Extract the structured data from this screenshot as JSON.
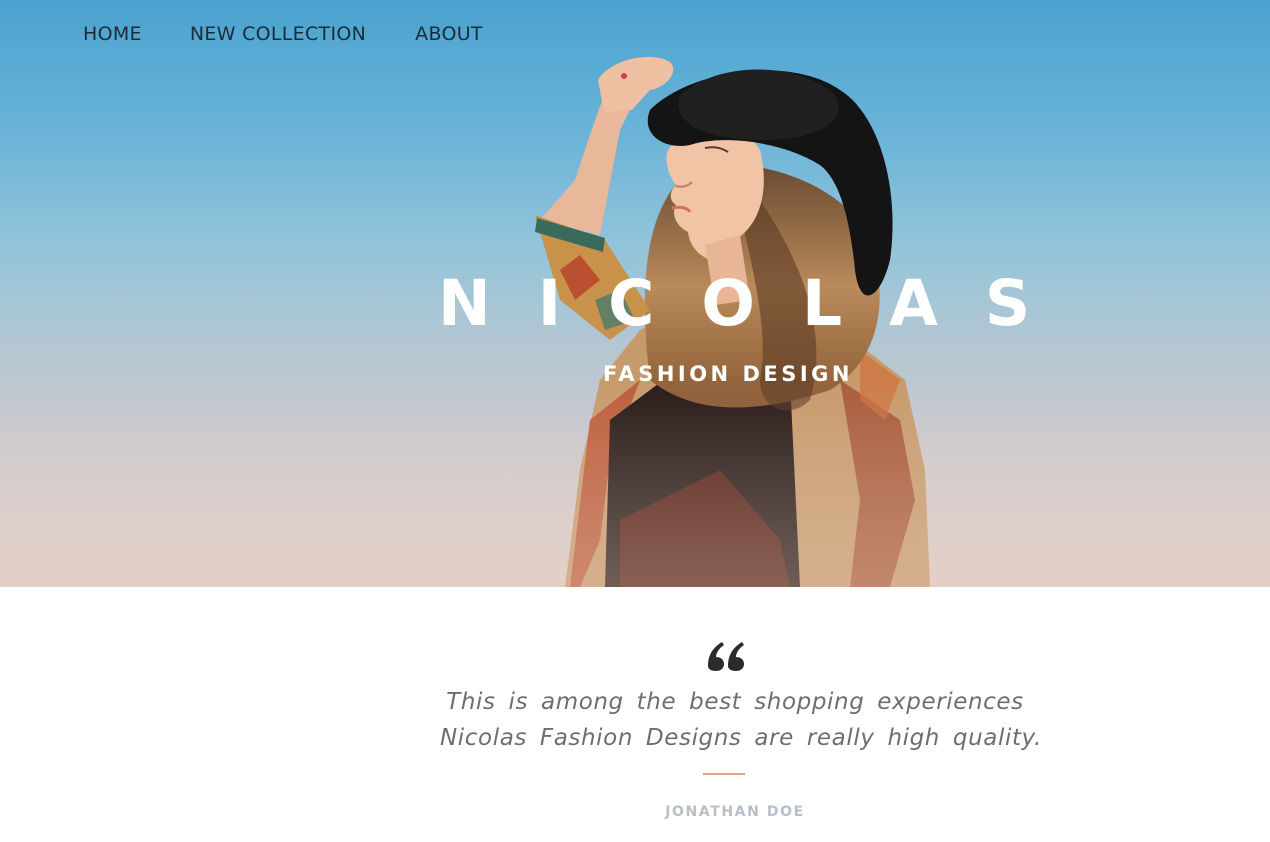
{
  "nav": {
    "items": [
      {
        "label": "HOME"
      },
      {
        "label": "NEW  COLLECTION"
      },
      {
        "label": "ABOUT"
      }
    ]
  },
  "hero": {
    "brand": "NICOLAS",
    "tagline": "FASHION DESIGN",
    "image_icon": "woman-in-hat-photo"
  },
  "testimonial": {
    "quote_icon": "quote-icon",
    "lines": [
      "This is among the best shopping experiences",
      "Nicolas Fashion Designs are really high quality."
    ],
    "author": "JONATHAN DOE",
    "accent_color": "#e6a08e"
  },
  "colors": {
    "sky_top": "#4aa3cf",
    "nav_text": "#1c2b36",
    "quote_text": "#6b6f73",
    "author_text": "#b9bfc6"
  }
}
